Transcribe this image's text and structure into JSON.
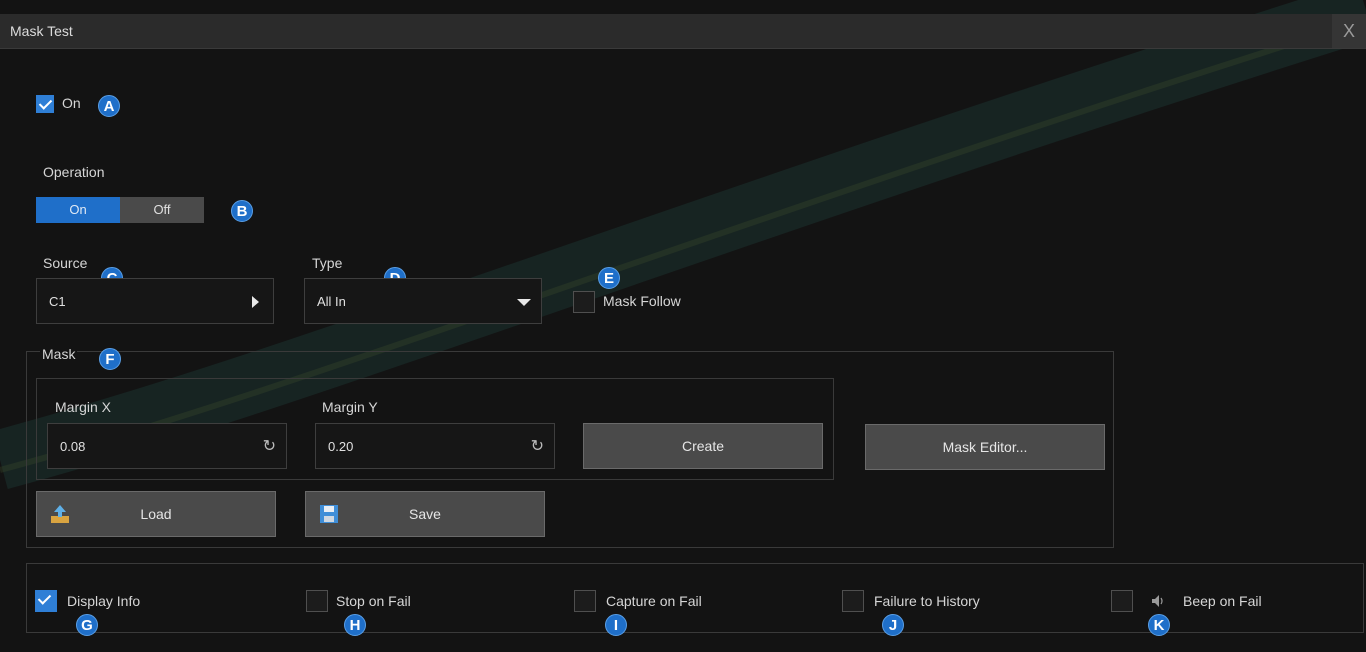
{
  "window": {
    "title": "Mask Test",
    "close_glyph": "X"
  },
  "enable": {
    "label": "On",
    "checked": true,
    "badge": "A"
  },
  "operation": {
    "label": "Operation",
    "options": [
      "On",
      "Off"
    ],
    "selected": "On",
    "badge": "B"
  },
  "source": {
    "label": "Source",
    "value": "C1",
    "badge": "C"
  },
  "type": {
    "label": "Type",
    "value": "All In",
    "badge": "D"
  },
  "mask_follow": {
    "label": "Mask Follow",
    "checked": false,
    "badge": "E"
  },
  "mask": {
    "label": "Mask",
    "badge": "F",
    "margin_x": {
      "label": "Margin X",
      "value": "0.08"
    },
    "margin_y": {
      "label": "Margin Y",
      "value": "0.20"
    },
    "create_label": "Create",
    "editor_label": "Mask Editor...",
    "load_label": "Load",
    "save_label": "Save"
  },
  "options": [
    {
      "label": "Display Info",
      "checked": true,
      "badge": "G"
    },
    {
      "label": "Stop on Fail",
      "checked": false,
      "badge": "H"
    },
    {
      "label": "Capture on Fail",
      "checked": false,
      "badge": "I"
    },
    {
      "label": "Failure to History",
      "checked": false,
      "badge": "J"
    },
    {
      "label": "Beep on Fail",
      "checked": false,
      "badge": "K"
    }
  ],
  "colors": {
    "accent": "#1f6fc9",
    "background": "#131313",
    "titlebar": "#2b2b2b",
    "button": "#4a4a4a"
  },
  "icons": {
    "refresh": "refresh-icon",
    "load": "upload-icon",
    "save": "floppy-icon",
    "beep": "speaker-icon"
  }
}
